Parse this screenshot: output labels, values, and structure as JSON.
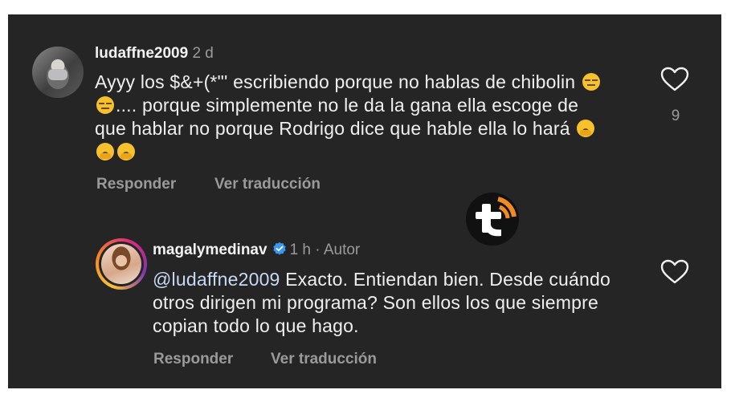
{
  "comments": [
    {
      "username": "ludaffne2009",
      "time": "2 d",
      "text": "Ayyy los $&+(*\"' escribiendo porque no hablas de chibolin ",
      "text_after_emoji1": ".... porque simplemente no le da la gana ella escoge de que hablar no porque Rodrigo dice que hable ella lo hará ",
      "emojis_first": [
        "expressionless-face",
        "expressionless-face"
      ],
      "emojis_end": [
        "yawning-face",
        "yawning-face",
        "yawning-face"
      ],
      "likes": "9",
      "reply_label": "Responder",
      "translate_label": "Ver traducción"
    },
    {
      "username": "magalymedinav",
      "verified": true,
      "time": "1 h",
      "role": "Autor",
      "mention": "@ludaffne2009",
      "text": " Exacto. Entiendan bien. Desde cuándo otros dirigen mi programa? Son ellos los que siempre copian todo lo que hago.",
      "reply_label": "Responder",
      "translate_label": "Ver traducción"
    }
  ],
  "colors": {
    "background": "#252525",
    "text": "#efefef",
    "muted": "#9a9a9a",
    "verified": "#3897f0",
    "logo_orange": "#f08a24"
  },
  "icons": [
    "heart-outline-icon",
    "verified-badge-icon",
    "watermark-logo"
  ]
}
